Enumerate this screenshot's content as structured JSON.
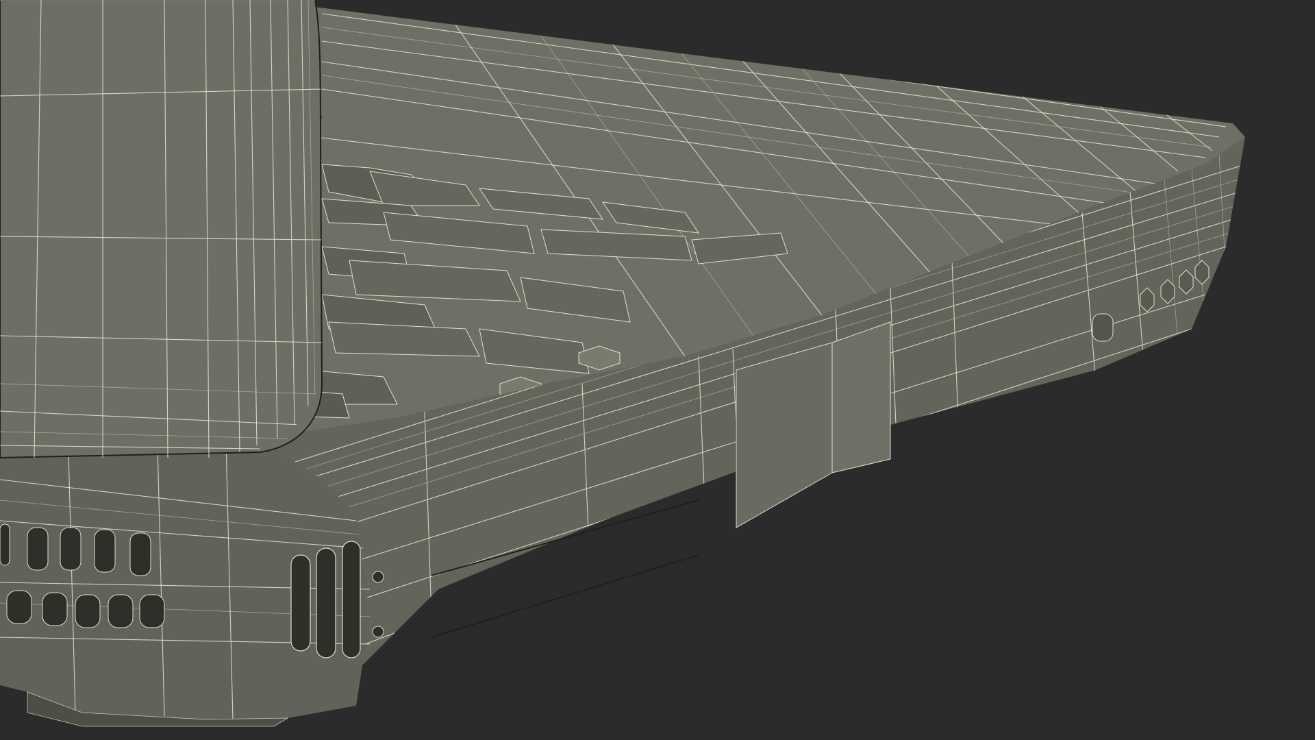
{
  "scene": {
    "subject": "",
    "render_style": "wireframe-over-solid",
    "colors": {
      "background": "#2b2b2b",
      "surface": "#6e6e64",
      "surface_light": "#7c7c71",
      "surface_dark": "#55554c",
      "shadow": "#3a3a34",
      "wire": "#e8e8d8"
    }
  }
}
